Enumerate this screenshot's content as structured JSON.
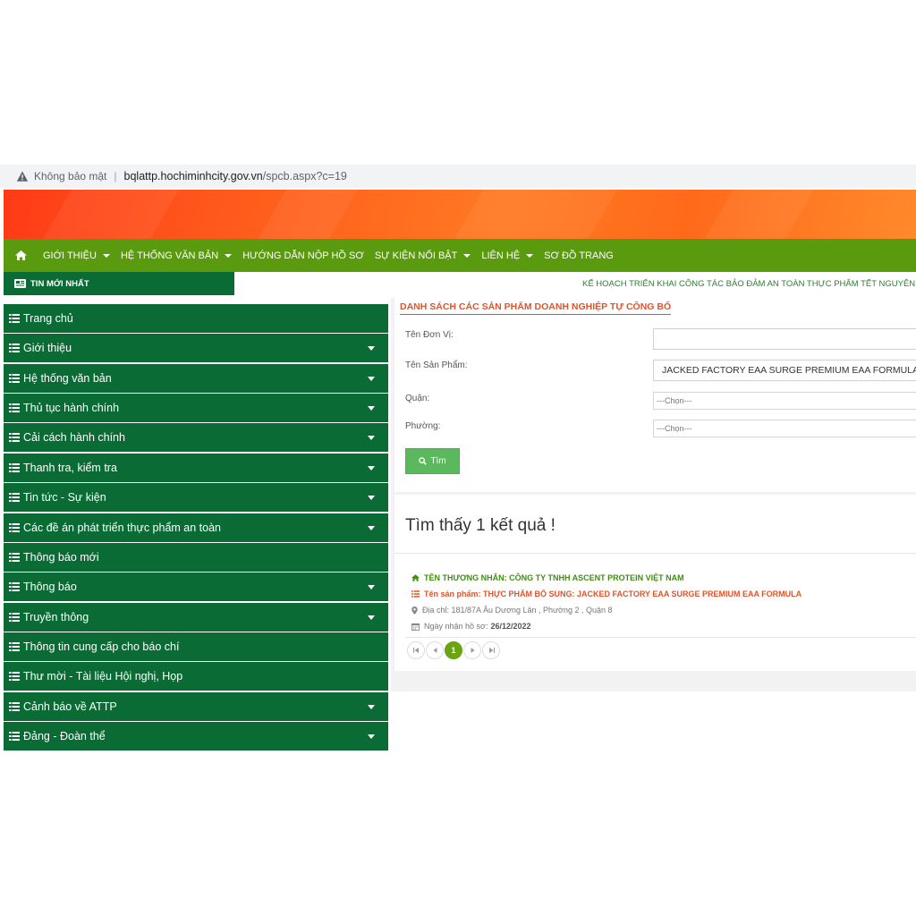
{
  "browser": {
    "security_label": "Không bảo mật",
    "url_host": "bqlattp.hochiminhcity.gov.vn",
    "url_path": "/spcb.aspx?c=19"
  },
  "nav": {
    "items": [
      {
        "label": "GIỚI THIỆU",
        "has_dropdown": true
      },
      {
        "label": "HỆ THỐNG VĂN BẢN",
        "has_dropdown": true
      },
      {
        "label": "HƯỚNG DẪN NỘP HỒ SƠ",
        "has_dropdown": false
      },
      {
        "label": "SỰ KIỆN NỔI BẬT",
        "has_dropdown": true
      },
      {
        "label": "LIÊN HỆ",
        "has_dropdown": true
      },
      {
        "label": "SƠ ĐỒ TRANG",
        "has_dropdown": false
      }
    ]
  },
  "news": {
    "label": "TIN MỚI NHẤT",
    "ticker": "KẾ HOẠCH TRIỂN KHAI CÔNG TÁC BẢO ĐẢM AN TOÀN THỰC PHẨM TẾT NGUYÊN Đ"
  },
  "sidebar": {
    "items": [
      {
        "label": "Trang chủ",
        "has_dropdown": false
      },
      {
        "label": "Giới thiệu",
        "has_dropdown": true
      },
      {
        "label": "Hệ thống văn bản",
        "has_dropdown": true
      },
      {
        "label": "Thủ tục hành chính",
        "has_dropdown": true
      },
      {
        "label": "Cải cách hành chính",
        "has_dropdown": true
      },
      {
        "label": "Thanh tra, kiểm tra",
        "has_dropdown": true
      },
      {
        "label": "Tin tức - Sự kiện",
        "has_dropdown": true
      },
      {
        "label": "Các đề án phát triển thực phẩm an toàn",
        "has_dropdown": true
      },
      {
        "label": "Thông báo mới",
        "has_dropdown": false
      },
      {
        "label": "Thông báo",
        "has_dropdown": true
      },
      {
        "label": "Truyền thông",
        "has_dropdown": true
      },
      {
        "label": "Thông tin cung cấp cho báo chí",
        "has_dropdown": false
      },
      {
        "label": "Thư mời - Tài liệu Hội nghị, Họp",
        "has_dropdown": false
      },
      {
        "label": "Cảnh báo về ATTP",
        "has_dropdown": true
      },
      {
        "label": "Đảng - Đoàn thể",
        "has_dropdown": true
      }
    ]
  },
  "search": {
    "title": "DANH SÁCH CÁC SẢN PHẨM DOANH NGHIỆP TỰ CÔNG BỐ",
    "unit_label": "Tên Đơn Vị:",
    "unit_value": "",
    "product_label": "Tên Sản Phẩm:",
    "product_value": "JACKED FACTORY EAA SURGE PREMIUM EAA FORMULA",
    "district_label": "Quận:",
    "district_value": "---Chọn---",
    "ward_label": "Phường:",
    "ward_value": "---Chọn---",
    "button_label": "Tìm"
  },
  "results": {
    "title": "Tìm thấy 1 kết quả !",
    "company": "TÊN THƯƠNG NHÂN: CÔNG TY TNHH ASCENT PROTEIN VIỆT NAM",
    "product": "Tên sản phẩm: THỰC PHẨM BỔ SUNG: JACKED FACTORY EAA SURGE PREMIUM EAA FORMULA",
    "address": "Địa chỉ: 181/87A Âu Dương Lân , Phường 2 , Quận 8",
    "date_label": "Ngày nhận hồ sơ:",
    "date_value": "26/12/2022",
    "current_page": "1"
  },
  "colors": {
    "nav_green": "#5a9a0e",
    "sidebar_green": "#0b6b35",
    "accent_orange": "#e2532a",
    "button_green": "#5cb85c"
  }
}
